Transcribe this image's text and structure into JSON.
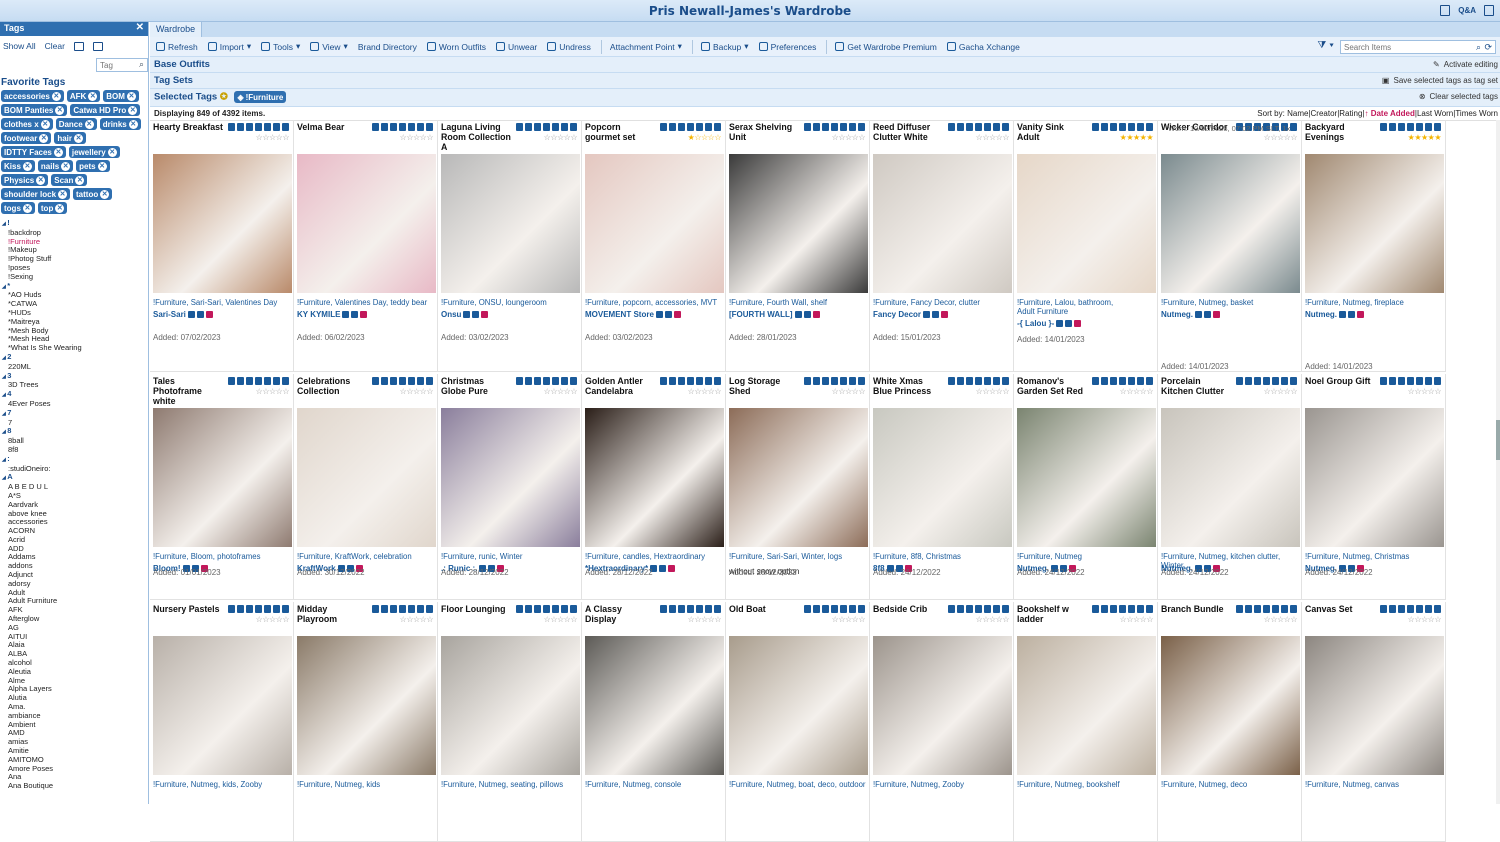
{
  "window": {
    "title": "Pris Newall-James's Wardrobe",
    "qa_label": "Q&A"
  },
  "tags_panel": {
    "title": "Tags",
    "show_all": "Show All",
    "clear": "Clear",
    "tag_placeholder": "Tag",
    "favorite_title": "Favorite Tags",
    "favorites": [
      "accessories",
      "AFK",
      "BOM",
      "BOM Panties",
      "Catwa HD Pro",
      "clothes x",
      "Dance",
      "drinks",
      "footwear",
      "hair",
      "IDTTY Faces",
      "jewellery",
      "Kiss",
      "nails",
      "pets",
      "Physics",
      "Scan",
      "shoulder lock",
      "tattoo",
      "togs",
      "top"
    ],
    "tree": [
      {
        "group": "!",
        "items": [
          "!backdrop",
          "!Furniture",
          "!Makeup",
          "!Photog Stuff",
          "!poses",
          "!Sexing"
        ]
      },
      {
        "group": "*",
        "items": [
          "*AO Huds",
          "*CATWA",
          "*HUDs",
          "*Maitreya",
          "*Mesh Body",
          "*Mesh Head",
          "*What Is She Wearing"
        ]
      },
      {
        "group": "2",
        "items": [
          "220ML"
        ]
      },
      {
        "group": "3",
        "items": [
          "3D Trees"
        ]
      },
      {
        "group": "4",
        "items": [
          "4Ever Poses"
        ]
      },
      {
        "group": "7",
        "items": [
          "7"
        ]
      },
      {
        "group": "8",
        "items": [
          "8ball",
          "8f8"
        ]
      },
      {
        "group": ":",
        "items": [
          ":studiOneiro:"
        ]
      },
      {
        "group": "A",
        "items": [
          "A B E D U L",
          "A*S",
          "Aardvark",
          "above knee",
          "accessories",
          "ACORN",
          "Acrid",
          "ADD",
          "Addams",
          "addons",
          "Adjunct",
          "adorsy",
          "Adult",
          "Adult Furniture",
          "AFK",
          "Afterglow",
          "AG",
          "AITUI",
          "Alaia",
          "ALBA",
          "alcohol",
          "Aleutia",
          "Alme",
          "Alpha Layers",
          "Alutia",
          "Ama.",
          "ambiance",
          "Ambient",
          "AMD",
          "amias",
          "Amitie",
          "AMITOMO",
          "Amore Poses",
          "Ana",
          "Ana Boutique"
        ]
      }
    ],
    "active_item": "!Furniture"
  },
  "main": {
    "tab": "Wardrobe",
    "toolbar": [
      "Refresh",
      "Import",
      "Tools",
      "View",
      "Brand Directory",
      "Worn Outfits",
      "Unwear",
      "Undress",
      "Attachment Point",
      "Backup",
      "Preferences",
      "Get Wardrobe Premium",
      "Gacha Xchange"
    ],
    "search_placeholder": "Search Items",
    "base_outfits": "Base Outfits",
    "activate_editing": "Activate editing",
    "tag_sets": "Tag Sets",
    "save_tags": "Save selected tags as tag set",
    "selected_tags": "Selected Tags",
    "selected_chip": "!Furniture",
    "clear_selected": "Clear selected tags",
    "displaying": "Displaying 849 of 4392 items.",
    "sort_label": "Sort by:",
    "sort_options": [
      "Name",
      "Creator",
      "Rating",
      "Date Added",
      "Last Worn",
      "Times Worn"
    ],
    "sort_active": "↑ Date Added",
    "worn_note": "Worn:  10/02/2023, 07:02 PM SLT, 1x"
  },
  "items": [
    {
      "name": "Hearty Breakfast",
      "tags": "!Furniture, Sari-Sari, Valentines Day",
      "creator": "Sari-Sari",
      "added": "Added: 07/02/2023",
      "rating": 0,
      "color": "#b98a6a"
    },
    {
      "name": "Velma Bear",
      "tags": "!Furniture, Valentines Day, teddy bear",
      "creator": "KY KYMILE",
      "added": "Added: 06/02/2023",
      "rating": 0,
      "color": "#e8b9c6"
    },
    {
      "name": "Laguna Living Room Collection A",
      "tags": "!Furniture, ONSU, loungeroom",
      "creator": "Onsu",
      "added": "Added: 03/02/2023",
      "rating": 0,
      "color": "#b8b8b8"
    },
    {
      "name": "Popcorn gourmet set",
      "tags": "!Furniture, popcorn, accessories, MVT",
      "creator": "MOVEMENT Store",
      "added": "Added: 03/02/2023",
      "rating": 1,
      "color": "#e4c7c0"
    },
    {
      "name": "Serax Shelving Unit",
      "tags": "!Furniture, Fourth Wall, shelf",
      "creator": "[FOURTH WALL]",
      "added": "Added: 28/01/2023",
      "rating": 0,
      "color": "#3a3a3a"
    },
    {
      "name": "Reed Diffuser Clutter White",
      "tags": "!Furniture, Fancy Decor, clutter",
      "creator": "Fancy Decor",
      "added": "Added: 15/01/2023",
      "rating": 0,
      "color": "#cfc9c2"
    },
    {
      "name": "Vanity Sink Adult",
      "tags": "!Furniture, Lalou, bathroom, Adult Furniture",
      "creator": "-{ Lalou }-",
      "added": "Added: 14/01/2023",
      "rating": 5,
      "color": "#e6d7c8"
    },
    {
      "name": "Wicker Corridor",
      "tags": "!Furniture, Nutmeg, basket",
      "creator": "Nutmeg.",
      "added": "Added: 14/01/2023",
      "rating": 0,
      "color": "#7a8a8e"
    },
    {
      "name": "Backyard Evenings",
      "tags": "!Furniture, Nutmeg, fireplace",
      "creator": "Nutmeg.",
      "added": "Added: 14/01/2023",
      "rating": 5,
      "color": "#a08870"
    },
    {
      "name": "Tales Photoframe white",
      "tags": "!Furniture, Bloom, photoframes",
      "creator": "Bloom!",
      "added": "Added: 01/01/2023",
      "rating": 0,
      "color": "#8e7a70"
    },
    {
      "name": "Celebrations Collection",
      "tags": "!Furniture, KraftWork, celebration",
      "creator": "KraftWork",
      "added": "Added: 30/12/2022",
      "rating": 0,
      "color": "#e0d6cc"
    },
    {
      "name": "Christmas Globe Pure",
      "tags": "!Furniture, runic, Winter",
      "creator": ".: Runic :.",
      "added": "Added: 28/12/2022",
      "rating": 0,
      "color": "#8a7e9c"
    },
    {
      "name": "Golden Antler Candelabra",
      "tags": "!Furniture, candles, Hextraordinary",
      "creator": "*Hextraordinary*",
      "added": "Added: 28/12/2022",
      "rating": 0,
      "color": "#2a1e18"
    },
    {
      "name": "Log Storage Shed",
      "tags": "!Furniture, Sari-Sari, Winter, logs",
      "creator": "",
      "note": "without snow option",
      "added": "Added: 28/12/2022",
      "rating": 0,
      "color": "#8c6c58"
    },
    {
      "name": "White Xmas Blue Princess",
      "tags": "!Furniture, 8f8, Christmas",
      "creator": "8f8",
      "added": "Added: 24/12/2022",
      "rating": 0,
      "color": "#c8c8c0"
    },
    {
      "name": "Romanov's Garden Set Red",
      "tags": "!Furniture, Nutmeg",
      "creator": "Nutmeg.",
      "added": "Added: 24/12/2022",
      "rating": 0,
      "color": "#7a8470"
    },
    {
      "name": "Porcelain Kitchen Clutter",
      "tags": "!Furniture, Nutmeg, kitchen clutter, Winter",
      "creator": "Nutmeg.",
      "added": "Added: 24/12/2022",
      "rating": 0,
      "color": "#c8c4bc"
    },
    {
      "name": "Noel Group Gift",
      "tags": "!Furniture, Nutmeg, Christmas",
      "creator": "Nutmeg.",
      "added": "Added: 24/12/2022",
      "rating": 0,
      "color": "#9a9590"
    },
    {
      "name": "Nursery Pastels",
      "tags": "!Furniture, Nutmeg, kids, Zooby",
      "creator": "",
      "added": "",
      "rating": 0,
      "color": "#b8b0a8"
    },
    {
      "name": "Midday Playroom",
      "tags": "!Furniture, Nutmeg, kids",
      "creator": "",
      "added": "",
      "rating": 0,
      "color": "#8a7a68"
    },
    {
      "name": "Floor Lounging",
      "tags": "!Furniture, Nutmeg, seating, pillows",
      "creator": "",
      "added": "",
      "rating": 0,
      "color": "#a8a49e"
    },
    {
      "name": "A Classy Display",
      "tags": "!Furniture, Nutmeg, console",
      "creator": "",
      "added": "",
      "rating": 0,
      "color": "#5c5a56"
    },
    {
      "name": "Old Boat",
      "tags": "!Furniture, Nutmeg, boat, deco, outdoor",
      "creator": "",
      "added": "",
      "rating": 0,
      "color": "#a89c8c"
    },
    {
      "name": "Bedside Crib",
      "tags": "!Furniture, Nutmeg, Zooby",
      "creator": "",
      "added": "",
      "rating": 0,
      "color": "#9c948c"
    },
    {
      "name": "Bookshelf w ladder",
      "tags": "!Furniture, Nutmeg, bookshelf",
      "creator": "",
      "added": "",
      "rating": 0,
      "color": "#bcb0a0"
    },
    {
      "name": "Branch Bundle",
      "tags": "!Furniture, Nutmeg, deco",
      "creator": "",
      "added": "",
      "rating": 0,
      "color": "#7a6048"
    },
    {
      "name": "Canvas Set",
      "tags": "!Furniture, Nutmeg, canvas",
      "creator": "",
      "added": "",
      "rating": 0,
      "color": "#8c8680"
    }
  ]
}
